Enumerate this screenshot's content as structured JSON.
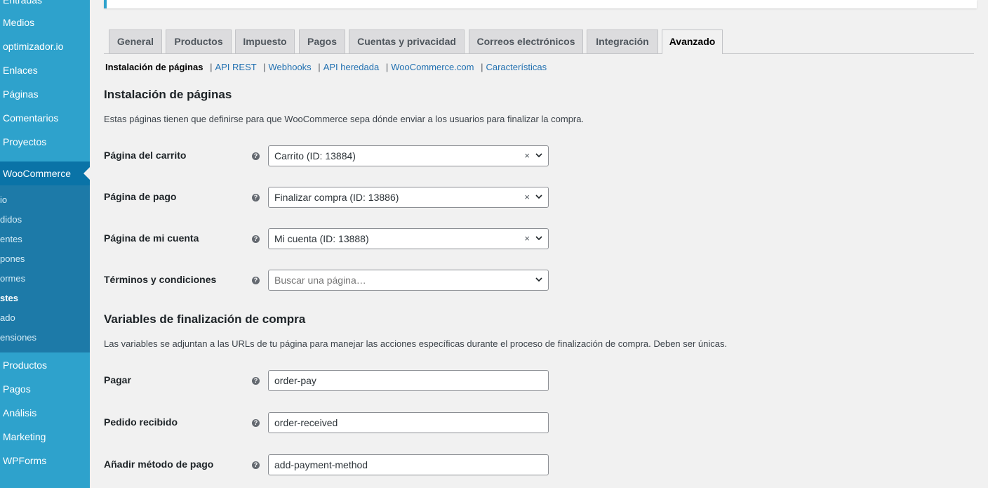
{
  "sidebar": {
    "top_partial": "Entradas",
    "items": [
      "Medios",
      "optimizador.io",
      "Enlaces",
      "Páginas",
      "Comentarios",
      "Proyectos"
    ],
    "current": "WooCommerce",
    "submenu": [
      "io",
      "didos",
      "entes",
      "pones",
      "ormes",
      "stes",
      "ado",
      "ensiones"
    ],
    "submenu_current_index": 5,
    "items_after": [
      "Productos",
      "Pagos",
      "Análisis",
      "Marketing",
      "WPForms"
    ],
    "bg_color": "#2ea2cc",
    "active_color": "#0a73a7"
  },
  "tabs": [
    {
      "label": "General",
      "active": false
    },
    {
      "label": "Productos",
      "active": false
    },
    {
      "label": "Impuesto",
      "active": false
    },
    {
      "label": "Pagos",
      "active": false
    },
    {
      "label": "Cuentas y privacidad",
      "active": false
    },
    {
      "label": "Correos electrónicos",
      "active": false
    },
    {
      "label": "Integración",
      "active": false
    },
    {
      "label": "Avanzado",
      "active": true
    }
  ],
  "subnav": {
    "current": "Instalación de páginas",
    "links": [
      "API REST",
      "Webhooks",
      "API heredada",
      "WooCommerce.com",
      "Características"
    ]
  },
  "section_pages": {
    "title": "Instalación de páginas",
    "description": "Estas páginas tienen que definirse para que WooCommerce sepa dónde enviar a los usuarios para finalizar la compra.",
    "fields": [
      {
        "label": "Página del carrito",
        "value": "Carrito (ID: 13884)",
        "clearable": true
      },
      {
        "label": "Página de pago",
        "value": "Finalizar compra (ID: 13886)",
        "clearable": true
      },
      {
        "label": "Página de mi cuenta",
        "value": "Mi cuenta (ID: 13888)",
        "clearable": true
      },
      {
        "label": "Términos y condiciones",
        "placeholder": "Buscar una página…",
        "clearable": false
      }
    ]
  },
  "section_checkout": {
    "title": "Variables de finalización de compra",
    "description": "Las variables se adjuntan a las URLs de tu página para manejar las acciones específicas durante el proceso de finalización de compra. Deben ser únicas.",
    "fields": [
      {
        "label": "Pagar",
        "value": "order-pay"
      },
      {
        "label": "Pedido recibido",
        "value": "order-received"
      },
      {
        "label": "Añadir método de pago",
        "value": "add-payment-method"
      }
    ]
  },
  "icons": {
    "help": "?",
    "clear": "×",
    "chevron": "chevron-down-icon"
  },
  "colors": {
    "link": "#2271b1",
    "accent": "#2ea2cc"
  }
}
